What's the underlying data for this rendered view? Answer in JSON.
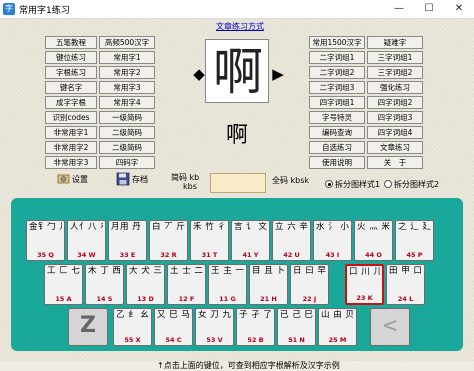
{
  "window": {
    "title": "常用字1练习",
    "controls": [
      "—",
      "☐",
      "✕"
    ]
  },
  "top_link": "文章练习方式",
  "left_buttons": [
    [
      "五笔教程",
      "高频500汉字"
    ],
    [
      "键位练习",
      "常用字1"
    ],
    [
      "字根练习",
      "常用字2"
    ],
    [
      "键名字",
      "常用字3"
    ],
    [
      "成字字根",
      "常用字4"
    ],
    [
      "识别codes",
      "一级简码"
    ],
    [
      "非常用字1",
      "二级简码"
    ],
    [
      "非常用字2",
      "二级简码"
    ],
    [
      "非常用字3",
      "四码字"
    ]
  ],
  "right_buttons": [
    [
      "常用1500汉字",
      "疑难字"
    ],
    [
      "二字词组1",
      "三字词组1"
    ],
    [
      "二字词组2",
      "三字词组2"
    ],
    [
      "二字词组3",
      "强化练习"
    ],
    [
      "四字词组1",
      "四字词组2"
    ],
    [
      "字号特灵",
      "四字词组3"
    ],
    [
      "编码查询",
      "四字词组4"
    ],
    [
      "自选练习",
      "文章练习"
    ],
    [
      "使用说明",
      "关　于"
    ]
  ],
  "current_char": "啊",
  "arrows": {
    "left": "◆",
    "right": "▶"
  },
  "tools": {
    "settings": "设置",
    "save": "存档"
  },
  "stats": {
    "code_label": "简码 kb",
    "speed_unit": "kbs",
    "full_code_label": "全码 kbsk"
  },
  "radios": [
    {
      "label": "拆分图样式1",
      "checked": true
    },
    {
      "label": "拆分图样式2",
      "checked": false
    }
  ],
  "keyboard": {
    "row1": [
      {
        "chars": "金钅勹 儿 夕夕",
        "code": "35 Q"
      },
      {
        "chars": "人亻八 癶",
        "code": "34 W"
      },
      {
        "chars": "月用 丹 彡 乃 衣",
        "code": "33 E"
      },
      {
        "chars": "白 丆 斤 手 扌",
        "code": "32 R"
      },
      {
        "chars": "禾 竹 彳 攵 丿",
        "code": "31 T"
      },
      {
        "chars": "言 讠 文 方 广 丶",
        "code": "41 Y"
      },
      {
        "chars": "立 六 辛 冫 丬 门",
        "code": "42 U"
      },
      {
        "chars": "水 氵 小 ⺌",
        "code": "43 I"
      },
      {
        "chars": "火 灬 米 业",
        "code": "44 O"
      },
      {
        "chars": "之 辶 廴 冖 宀",
        "code": "45 P"
      }
    ],
    "row2": [
      {
        "chars": "工 匚 七 弋 戈 艹",
        "code": "15 A"
      },
      {
        "chars": "木 丁 西",
        "code": "14 S"
      },
      {
        "chars": "大 犬 三 古 石 厂",
        "code": "13 D"
      },
      {
        "chars": "土 士 二 干 十 寸 雨",
        "code": "12 F"
      },
      {
        "chars": "王 主 一 五 戋",
        "code": "11 G"
      },
      {
        "chars": "目 且 卜 上 止 丨",
        "code": "21 H"
      },
      {
        "chars": "日 曰 早 虫 刂",
        "code": "22 J"
      },
      {
        "chars": "口 川 儿",
        "code": "23 K"
      },
      {
        "chars": "田 甲 口 四 车 力 皿",
        "code": "24 L"
      }
    ],
    "row3": [
      {
        "chars": "乙 纟 幺 弓 匕 匕",
        "code": "55 X"
      },
      {
        "chars": "又 巳 马 厶",
        "code": "54 C"
      },
      {
        "chars": "女 刀 九 臼 彐",
        "code": "53 V"
      },
      {
        "chars": "子 孑 了 耳 阝 卩",
        "code": "52 B"
      },
      {
        "chars": "已 己 巳 乙 尸 心 羽",
        "code": "51 N"
      },
      {
        "chars": "山 由 贝 冂 几",
        "code": "25 M"
      }
    ],
    "z_key": "Z",
    "back_key": "<"
  },
  "footer": "↑点击上面的键位，可查到相应字根解析及汉字示例"
}
